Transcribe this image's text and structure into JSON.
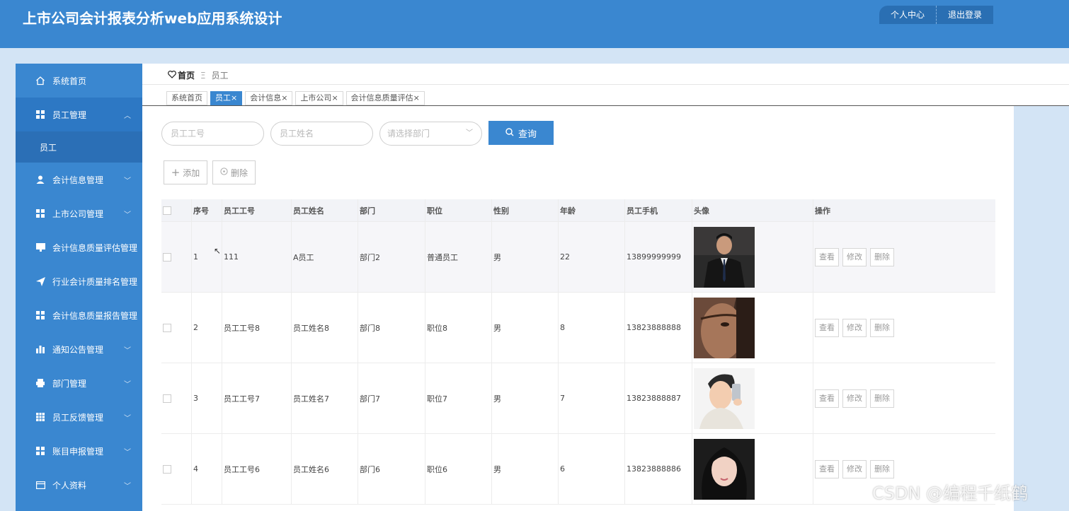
{
  "header": {
    "title": "上市公司会计报表分析web应用系统设计",
    "buttons": [
      "个人中心",
      "退出登录"
    ]
  },
  "sidebar": {
    "items": [
      {
        "label": "系统首页",
        "icon": "home-icon"
      },
      {
        "label": "员工管理",
        "icon": "grid-icon",
        "expanded": true,
        "sub": [
          "员工"
        ]
      },
      {
        "label": "会计信息管理",
        "icon": "user-icon"
      },
      {
        "label": "上市公司管理",
        "icon": "grid-icon"
      },
      {
        "label": "会计信息质量评估管理",
        "icon": "monitor-icon"
      },
      {
        "label": "行业会计质量排名管理",
        "icon": "send-icon"
      },
      {
        "label": "会计信息质量报告管理",
        "icon": "grid-icon"
      },
      {
        "label": "通知公告管理",
        "icon": "bar-chart-icon"
      },
      {
        "label": "部门管理",
        "icon": "printer-icon"
      },
      {
        "label": "员工反馈管理",
        "icon": "table-icon"
      },
      {
        "label": "账目申报管理",
        "icon": "grid-icon"
      },
      {
        "label": "个人资料",
        "icon": "card-icon"
      }
    ]
  },
  "breadcrumb": {
    "home": "首页",
    "separator": "Ξ",
    "current": "员工"
  },
  "tabs": [
    {
      "label": "系统首页",
      "closable": false
    },
    {
      "label": "员工",
      "closable": true,
      "active": true
    },
    {
      "label": "会计信息",
      "closable": true
    },
    {
      "label": "上市公司",
      "closable": true
    },
    {
      "label": "会计信息质量评估",
      "closable": true
    }
  ],
  "search": {
    "emp_no_placeholder": "员工工号",
    "emp_name_placeholder": "员工姓名",
    "dept_placeholder": "请选择部门",
    "query_label": "查询"
  },
  "actions": {
    "add_label": "添加",
    "delete_label": "删除"
  },
  "table": {
    "columns": [
      "序号",
      "员工工号",
      "员工姓名",
      "部门",
      "职位",
      "性别",
      "年龄",
      "员工手机",
      "头像",
      "操作"
    ],
    "op_labels": [
      "查看",
      "修改",
      "删除"
    ],
    "rows": [
      {
        "no": "1",
        "emp_no": "111",
        "name": "A员工",
        "dept": "部门2",
        "position": "普通员工",
        "gender": "男",
        "age": "22",
        "phone": "13899999999"
      },
      {
        "no": "2",
        "emp_no": "员工工号8",
        "name": "员工姓名8",
        "dept": "部门8",
        "position": "职位8",
        "gender": "男",
        "age": "8",
        "phone": "13823888888"
      },
      {
        "no": "3",
        "emp_no": "员工工号7",
        "name": "员工姓名7",
        "dept": "部门7",
        "position": "职位7",
        "gender": "男",
        "age": "7",
        "phone": "13823888887"
      },
      {
        "no": "4",
        "emp_no": "员工工号6",
        "name": "员工姓名6",
        "dept": "部门6",
        "position": "职位6",
        "gender": "男",
        "age": "6",
        "phone": "13823888886"
      }
    ]
  },
  "watermark": "CSDN @编程千纸鹤",
  "colors": {
    "primary": "#3a87d0",
    "sidebar_active": "#2b6fb6",
    "background": "#d3e4f5"
  }
}
